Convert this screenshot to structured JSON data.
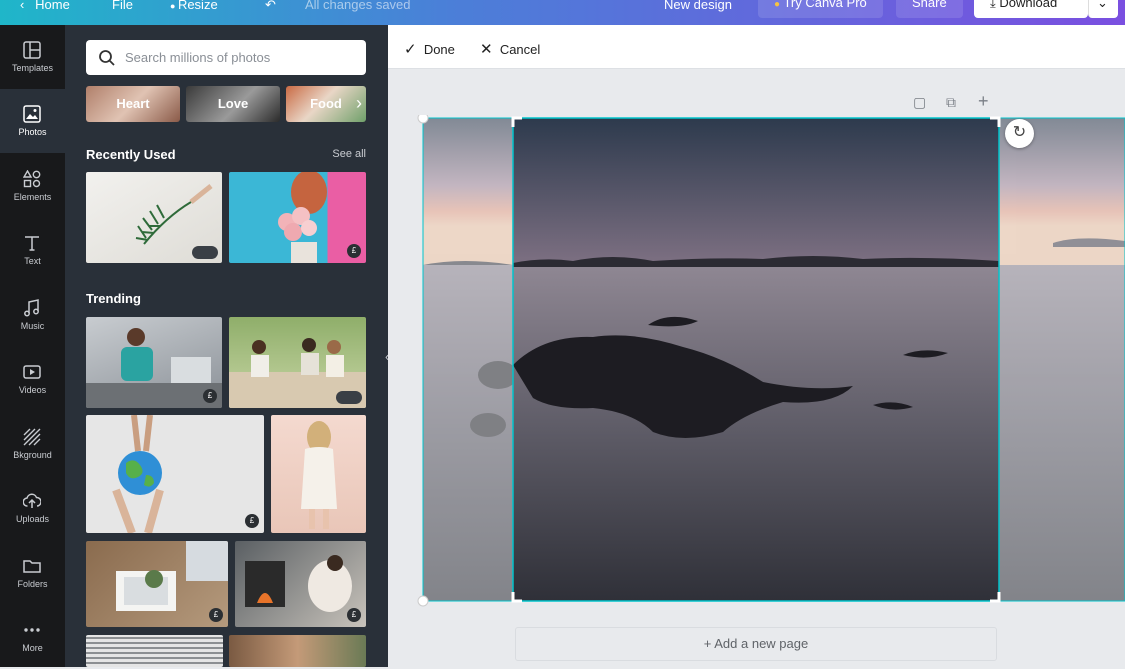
{
  "topbar": {
    "home": "Home",
    "file": "File",
    "resize": "Resize",
    "saved": "All changes saved",
    "new_design": "New design",
    "try_pro": "Try Canva Pro",
    "share": "Share",
    "download": "Download"
  },
  "sidebar": {
    "items": [
      {
        "label": "Templates",
        "icon": "templates-icon"
      },
      {
        "label": "Photos",
        "icon": "photos-icon"
      },
      {
        "label": "Elements",
        "icon": "elements-icon"
      },
      {
        "label": "Text",
        "icon": "text-icon"
      },
      {
        "label": "Music",
        "icon": "music-icon"
      },
      {
        "label": "Videos",
        "icon": "videos-icon"
      },
      {
        "label": "Bkground",
        "icon": "background-icon"
      },
      {
        "label": "Uploads",
        "icon": "uploads-icon"
      },
      {
        "label": "Folders",
        "icon": "folders-icon"
      },
      {
        "label": "More",
        "icon": "more-icon"
      }
    ]
  },
  "panel": {
    "search_placeholder": "Search millions of photos",
    "chips": [
      "Heart",
      "Love",
      "Food"
    ],
    "recent_title": "Recently Used",
    "see_all": "See all",
    "trending_title": "Trending",
    "pound": "£"
  },
  "editor": {
    "done": "Done",
    "cancel": "Cancel",
    "add_page": "+ Add a new page"
  },
  "colors": {
    "accent": "#00c4cc",
    "sidebar": "#18191b",
    "panel": "#293039"
  }
}
